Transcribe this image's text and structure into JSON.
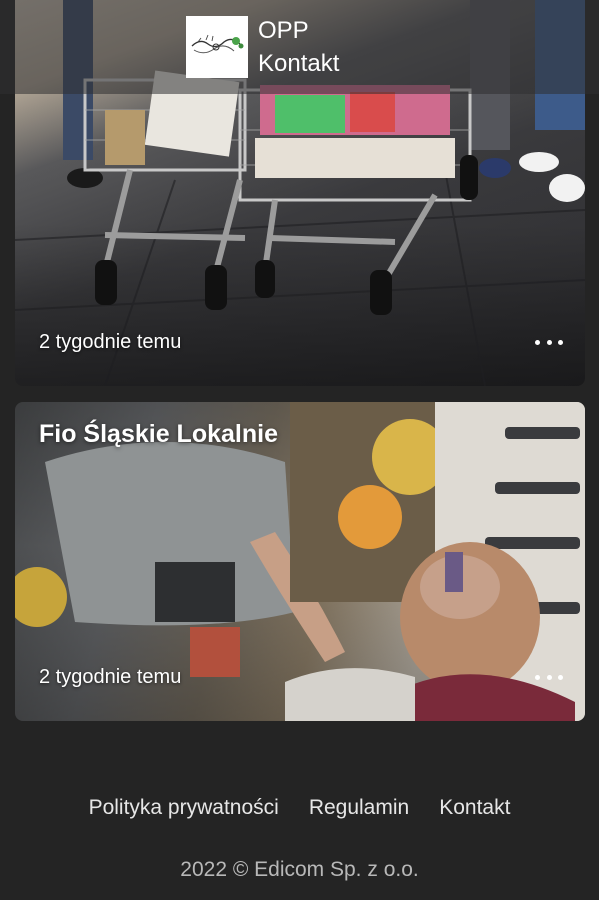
{
  "header": {
    "logo_icon": "opp-logo-icon",
    "nav": [
      "OPP",
      "Kontakt"
    ]
  },
  "posts": [
    {
      "title": "",
      "time": "2 tygodnie temu",
      "more_icon": "more-dots-icon"
    },
    {
      "title": "Fio Śląskie Lokalnie",
      "time": "2 tygodnie temu",
      "more_icon": "more-dots-icon"
    }
  ],
  "footer": {
    "links": [
      "Polityka prywatności",
      "Regulamin",
      "Kontakt"
    ],
    "copyright": "2022 © Edicom Sp. z o.o."
  },
  "colors": {
    "background": "#242424",
    "header_overlay": "#303032",
    "text": "#ffffff",
    "footer_text": "#e6e6e6",
    "copyright_text": "#b8b8b8"
  }
}
